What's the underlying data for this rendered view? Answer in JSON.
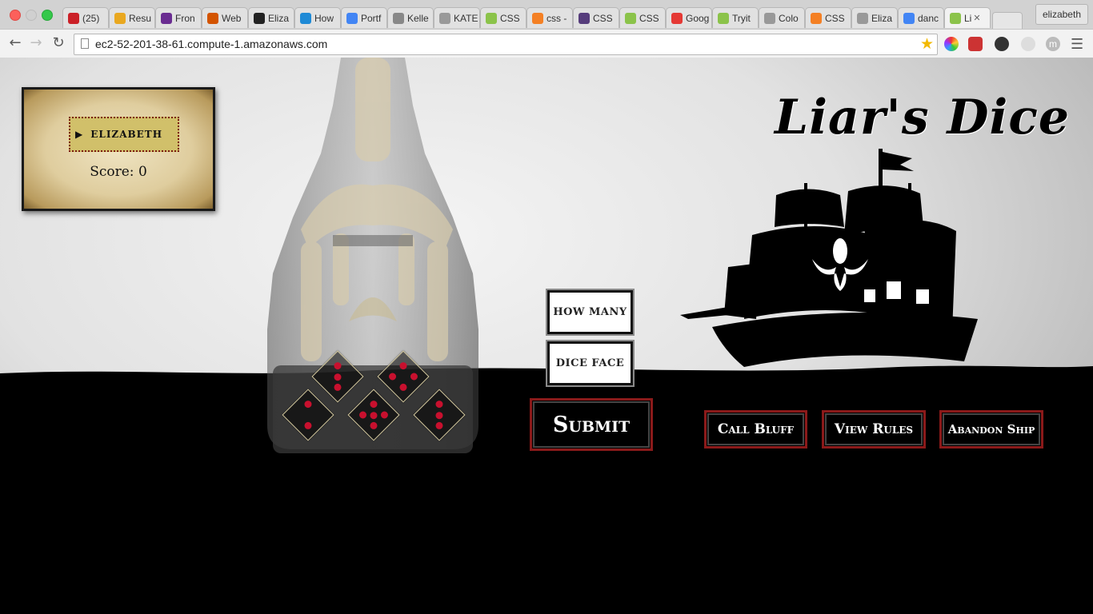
{
  "browser": {
    "tabs": [
      {
        "label": "(25)",
        "icon": "pinterest-icon",
        "color": "#cb2027"
      },
      {
        "label": "Resu",
        "icon": "slack-icon",
        "color": "#e9a820"
      },
      {
        "label": "Fron",
        "icon": "peace-icon",
        "color": "#6a2c91"
      },
      {
        "label": "Web",
        "icon": "grid-icon",
        "color": "#d35400"
      },
      {
        "label": "Eliza",
        "icon": "github-icon",
        "color": "#222222"
      },
      {
        "label": "How",
        "icon": "sitepoint-icon",
        "color": "#1f8ad6"
      },
      {
        "label": "Portf",
        "icon": "docs-icon",
        "color": "#4285f4"
      },
      {
        "label": "Kelle",
        "icon": "kr-icon",
        "color": "#888888"
      },
      {
        "label": "KATE",
        "icon": "page-icon",
        "color": "#999999"
      },
      {
        "label": "CSS",
        "icon": "w3-icon",
        "color": "#8bc34a"
      },
      {
        "label": "css -",
        "icon": "stackoverflow-icon",
        "color": "#f48024"
      },
      {
        "label": "CSS",
        "icon": "bootstrap-icon",
        "color": "#563d7c"
      },
      {
        "label": "CSS",
        "icon": "w3-icon",
        "color": "#8bc34a"
      },
      {
        "label": "Goog",
        "icon": "fonts-icon",
        "color": "#e53935"
      },
      {
        "label": "Tryit",
        "icon": "w3-icon",
        "color": "#8bc34a"
      },
      {
        "label": "Colo",
        "icon": "page-icon",
        "color": "#999999"
      },
      {
        "label": "CSS",
        "icon": "stackoverflow-icon",
        "color": "#f48024"
      },
      {
        "label": "Eliza",
        "icon": "page-icon",
        "color": "#999999"
      },
      {
        "label": "danc",
        "icon": "google-icon",
        "color": "#4285f4"
      },
      {
        "label": "Li",
        "icon": "leaf-icon",
        "color": "#8bc34a",
        "active": true
      }
    ],
    "profile": "elizabeth",
    "url": "ec2-52-201-38-61.compute-1.amazonaws.com",
    "ext5_letter": "m"
  },
  "game": {
    "title": "Liar's Dice",
    "player": {
      "name": "ELIZABETH",
      "score_label": "Score: 0"
    },
    "bid": {
      "how_many": "HOW MANY",
      "dice_face": "DICE FACE"
    },
    "buttons": {
      "submit": "Submit",
      "call_bluff": "Call Bluff",
      "view_rules": "View Rules",
      "abandon_ship": "Abandon Ship"
    },
    "dice": [
      3,
      4,
      2,
      5,
      3
    ],
    "colors": {
      "pip": "#c8102e",
      "button_border": "#8b1a1a",
      "name_box": "#d1c06a"
    }
  }
}
